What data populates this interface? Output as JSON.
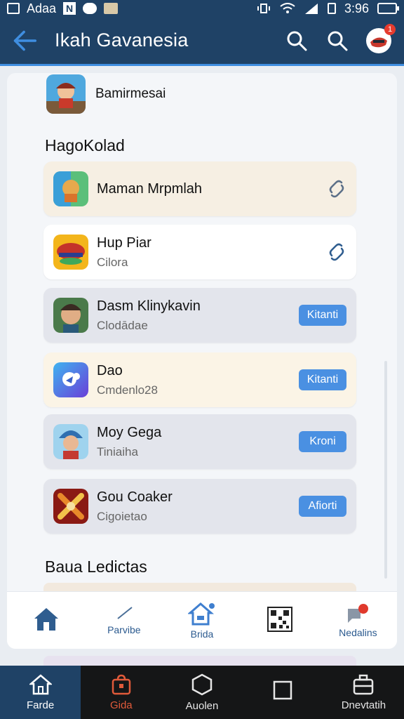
{
  "status_bar": {
    "carrier": "Adaa",
    "time": "3:96",
    "icons": [
      "image-icon",
      "n-icon",
      "cat-icon",
      "photo-icon",
      "vibrate-icon",
      "wifi-icon",
      "signal-icon",
      "battery-icon"
    ]
  },
  "app_bar": {
    "title": "Ikah Gavanesia",
    "badge_count": "1",
    "icons": [
      "back-arrow-icon",
      "search-icon",
      "search-icon",
      "profile-icon"
    ]
  },
  "top_item": {
    "label": "Bamirmesai"
  },
  "sections": {
    "first_heading": "HagoKolad",
    "second_heading": "Baua Ledictas"
  },
  "rows": [
    {
      "title": "Maman Mrpmlah",
      "subtitle": "",
      "trailing": "link",
      "bg": "#f6efe3"
    },
    {
      "title": "Hup Piar",
      "subtitle": "Cilora",
      "trailing": "link",
      "bg": "#ffffff"
    },
    {
      "title": "Dasm Klinykavin",
      "subtitle": "Clodādae",
      "trailing": "button",
      "button_label": "Kitanti",
      "bg": "#e3e5ec"
    },
    {
      "title": "Dao",
      "subtitle": "Cmdenlo28",
      "trailing": "button",
      "button_label": "Kitanti",
      "bg": "#fbf4e6"
    },
    {
      "title": "Moy Gega",
      "subtitle": "Tiniaiha",
      "trailing": "button",
      "button_label": "Kroni",
      "bg": "#e3e5ec"
    },
    {
      "title": "Gou Coaker",
      "subtitle": "Cigoietao",
      "trailing": "button",
      "button_label": "Afiorti",
      "bg": "#e3e5ec"
    }
  ],
  "inner_nav": [
    {
      "label": "",
      "icon": "home-icon"
    },
    {
      "label": "Parvibe",
      "icon": "pen-icon"
    },
    {
      "label": "Brida",
      "icon": "store-icon"
    },
    {
      "label": "",
      "icon": "qr-code-icon"
    },
    {
      "label": "Nedalins",
      "icon": "notification-icon"
    }
  ],
  "system_nav": [
    {
      "label": "Farde",
      "icon": "home-icon"
    },
    {
      "label": "Gida",
      "icon": "bag-icon"
    },
    {
      "label": "Auolen",
      "icon": "hexagon-icon"
    },
    {
      "label": "",
      "icon": "square-icon"
    },
    {
      "label": "Dnevtatih",
      "icon": "briefcase-icon"
    }
  ],
  "colors": {
    "header": "#1f4266",
    "accent": "#3f8ee0",
    "button": "#4a90e2",
    "badge": "#e63b2e"
  }
}
